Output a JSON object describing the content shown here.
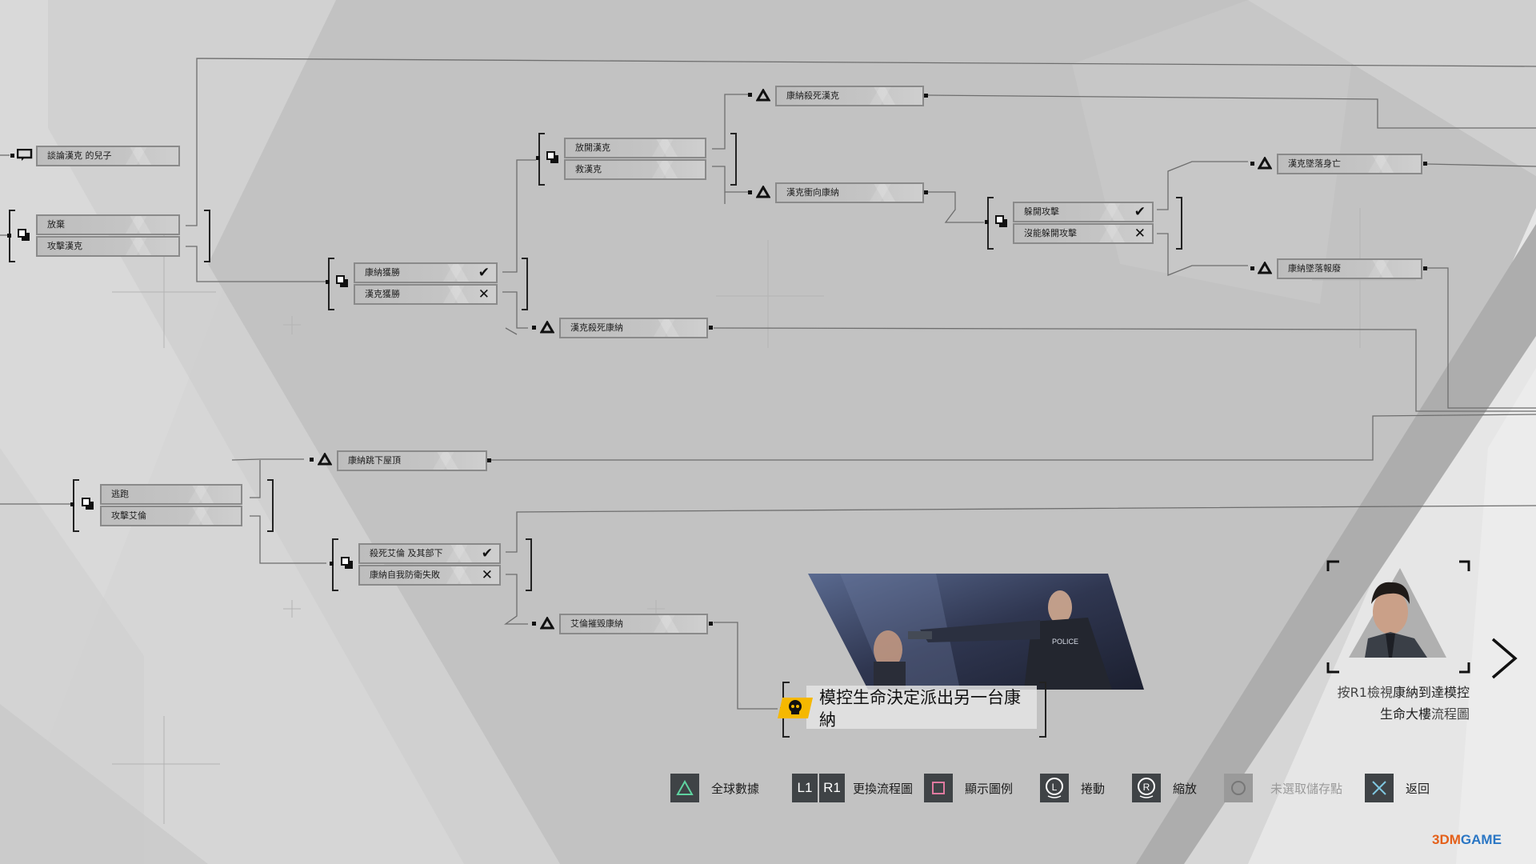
{
  "flowchart": {
    "nodes": {
      "talk_son": "談論漢克 的兒子",
      "give_up": "放棄",
      "attack_hank": "攻擊漢克",
      "connor_wins": "康納獲勝",
      "hank_wins": "漢克獲勝",
      "release_hank": "放開漢克",
      "save_hank": "救漢克",
      "connor_kills_hank": "康納殺死漢克",
      "hank_rushes_connor": "漢克衝向康納",
      "dodge_attack": "躲開攻擊",
      "fail_dodge": "沒能躲開攻擊",
      "hank_falls_dies": "漢克墜落身亡",
      "connor_falls_destroyed": "康納墜落報廢",
      "hank_kills_connor": "漢克殺死康納",
      "connor_jumps_roof": "康納跳下屋頂",
      "flee": "逃跑",
      "attack_allen": "攻擊艾倫",
      "kill_allen_men": "殺死艾倫 及其部下",
      "connor_defense_fail": "康納自我防衛失敗",
      "allen_destroys_connor": "艾倫摧毀康納"
    },
    "marks": {
      "check": "✔",
      "cross": "✕"
    },
    "ending": {
      "text": "模控生命決定派出另一台康納",
      "icon": "skull-icon",
      "accent_color": "#f5b800"
    }
  },
  "next_chapter": {
    "caption_line1_prefix": "按R1檢視",
    "caption_line1_bold": "康納到達模控",
    "caption_line2_bold": "生命大樓",
    "caption_line2_suffix": "流程圖"
  },
  "bottom_bar": {
    "buttons": [
      {
        "key": "triangle",
        "label": "全球數據",
        "color": "#5fd3a0"
      },
      {
        "key": "L1 R1",
        "label": "更換流程圖"
      },
      {
        "key": "square",
        "label": "顯示圖例",
        "color": "#e07aa0"
      },
      {
        "key": "L",
        "label": "捲動"
      },
      {
        "key": "R",
        "label": "縮放"
      },
      {
        "key": "circle",
        "label": "未選取儲存點",
        "disabled": true
      },
      {
        "key": "cross",
        "label": "返回",
        "color": "#7fc7e0"
      }
    ],
    "l1": "L1",
    "r1": "R1",
    "l_stick": "L",
    "r_stick": "R"
  },
  "watermark": {
    "brand_a": "3DM",
    "brand_b": "GAME"
  }
}
